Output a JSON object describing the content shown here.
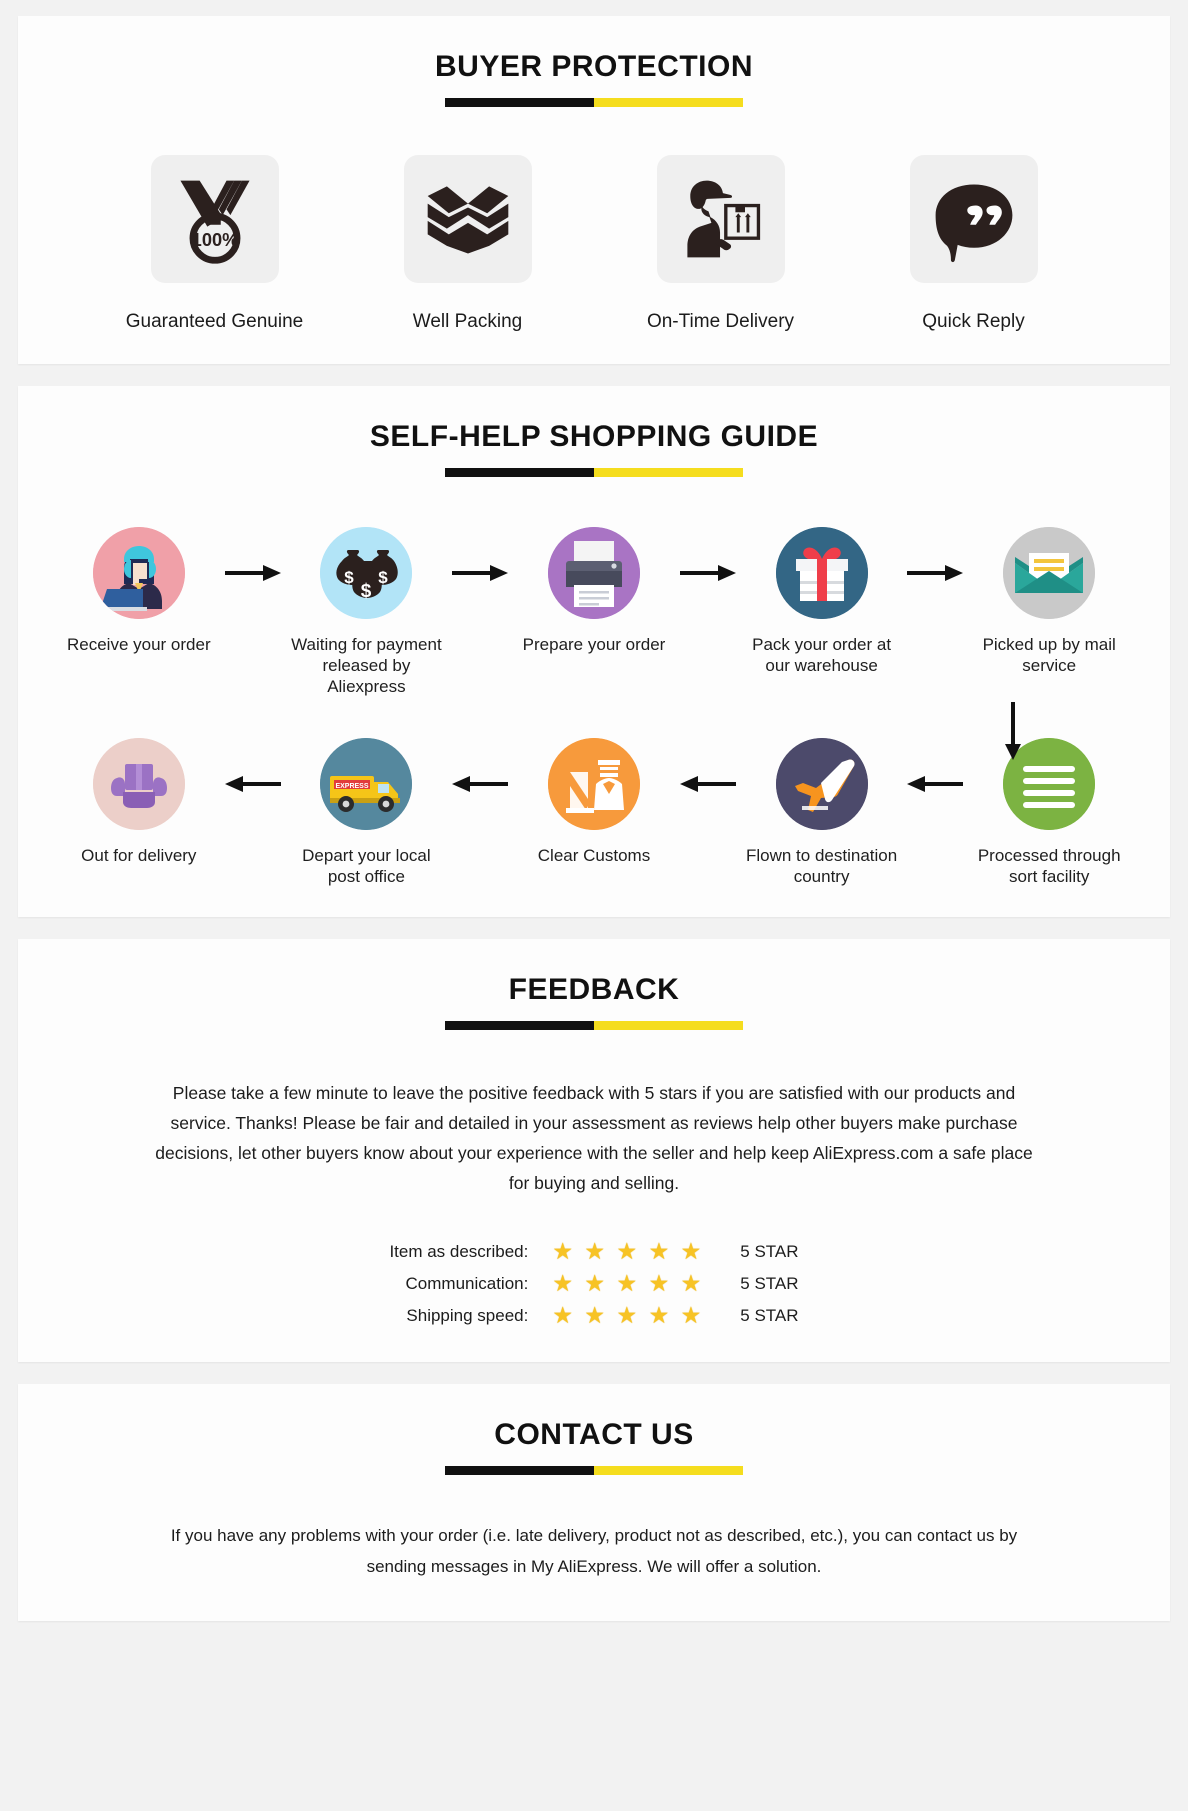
{
  "buyer_protection": {
    "title": "BUYER PROTECTION",
    "items": [
      {
        "label": "Guaranteed Genuine",
        "icon": "medal-100-percent-icon",
        "badge_text": "100%"
      },
      {
        "label": "Well Packing",
        "icon": "open-box-icon"
      },
      {
        "label": "On-Time Delivery",
        "icon": "delivery-courier-icon"
      },
      {
        "label": "Quick Reply",
        "icon": "speech-bubble-icon"
      }
    ]
  },
  "shopping_guide": {
    "title": "SELF-HELP SHOPPING GUIDE",
    "row1": [
      {
        "label": "Receive your order",
        "icon": "support-agent-icon",
        "color": "#f0a0a8"
      },
      {
        "label": "Waiting for payment released by Aliexpress",
        "icon": "money-bags-icon",
        "color": "#b2e4f7"
      },
      {
        "label": "Prepare your order",
        "icon": "printer-icon",
        "color": "#a974c4"
      },
      {
        "label": "Pack your order at our warehouse",
        "icon": "gift-box-icon",
        "color": "#336685"
      },
      {
        "label": "Picked up by mail service",
        "icon": "envelope-icon",
        "color": "#c9c9c9"
      }
    ],
    "row2": [
      {
        "label": "Processed through sort facility",
        "icon": "sorting-facility-icon",
        "color": "#7cb342"
      },
      {
        "label": "Flown to destination country",
        "icon": "airplane-icon",
        "color": "#4c4a6b"
      },
      {
        "label": "Clear Customs",
        "icon": "customs-officer-icon",
        "color": "#f79a3c"
      },
      {
        "label": "Depart your local post office",
        "icon": "delivery-truck-icon",
        "color": "#55889e"
      },
      {
        "label": "Out for delivery",
        "icon": "hands-package-icon",
        "color": "#eccfc9"
      }
    ]
  },
  "feedback": {
    "title": "FEEDBACK",
    "paragraph": "Please take a few minute to leave the positive feedback with 5 stars if you are satisfied with our products and service. Thanks! Please be fair and detailed in your assessment as reviews help other buyers make purchase decisions, let other buyers know about your experience with the seller and help keep AliExpress.com a safe place for buying and selling.",
    "ratings": [
      {
        "label": "Item as described:",
        "stars": 5,
        "value": "5 STAR"
      },
      {
        "label": "Communication:",
        "stars": 5,
        "value": "5 STAR"
      },
      {
        "label": "Shipping speed:",
        "stars": 5,
        "value": "5 STAR"
      }
    ],
    "star_glyph": "★",
    "star_color": "#f7c325"
  },
  "contact": {
    "title": "CONTACT US",
    "paragraph": "If you have any problems with your order (i.e. late delivery, product not as described, etc.), you can contact us by sending messages in My AliExpress. We will offer a solution."
  },
  "theme": {
    "divider_dark": "#111111",
    "divider_accent": "#f5dd1e",
    "card_bg": "#fdfdfd",
    "page_bg": "#f2f2f2"
  }
}
